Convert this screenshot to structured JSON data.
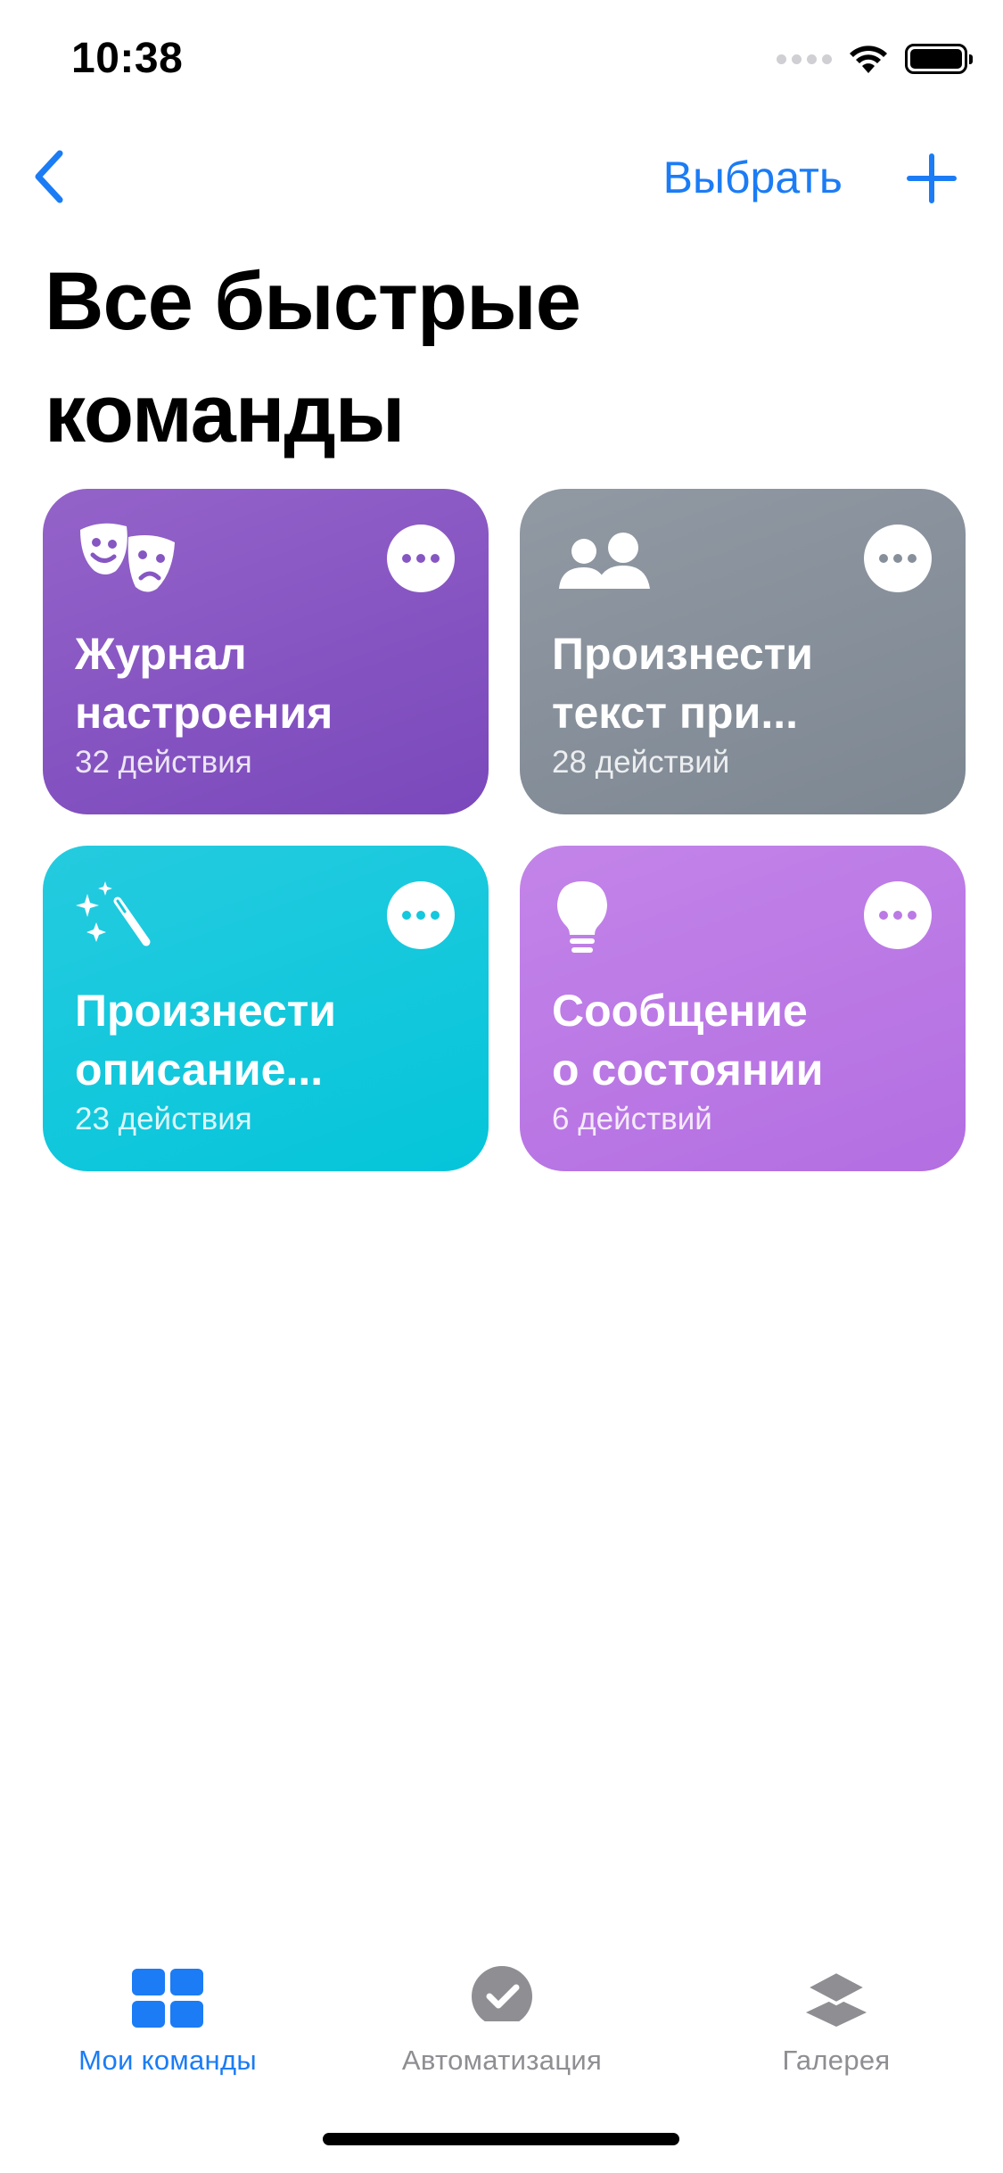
{
  "status_bar": {
    "time": "10:38"
  },
  "nav": {
    "back_icon": "chevron-left-icon",
    "select_label": "Выбрать",
    "add_icon": "plus-icon",
    "accent_color": "#1b7cf5"
  },
  "title_line1": "Все быстрые",
  "title_line2": "команды",
  "shortcuts": [
    {
      "title_line1": "Журнал",
      "title_line2": "настроения",
      "subtitle": "32 действия",
      "icon": "theater-masks-icon",
      "color": "#8656c3"
    },
    {
      "title_line1": "Произнести",
      "title_line2": "текст при...",
      "subtitle": "28 действий",
      "icon": "people-icon",
      "color": "#87909a"
    },
    {
      "title_line1": "Произнести",
      "title_line2": "описание...",
      "subtitle": "23 действия",
      "icon": "magic-wand-icon",
      "color": "#14c8dd"
    },
    {
      "title_line1": "Сообщение",
      "title_line2": "о состоянии",
      "subtitle": "6 действий",
      "icon": "lightbulb-icon",
      "color": "#bb7ae5"
    }
  ],
  "tabs": [
    {
      "label": "Мои команды",
      "icon": "grid-icon",
      "active": true
    },
    {
      "label": "Автоматизация",
      "icon": "clock-check-icon",
      "active": false
    },
    {
      "label": "Галерея",
      "icon": "layers-icon",
      "active": false
    }
  ]
}
